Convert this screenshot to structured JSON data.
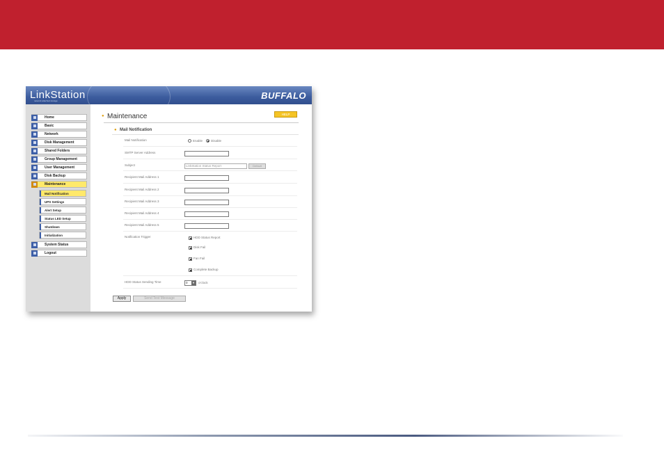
{
  "colors": {
    "banner": "#c0202e",
    "header": "#3c5c9e",
    "accent_yellow": "#ffe96a",
    "nav_icon": "#3d5fa7"
  },
  "header": {
    "logo_text": "LinkStation",
    "logo_tagline": "network attached storage",
    "brand": "BUFFALO"
  },
  "sidebar": {
    "items": [
      {
        "label": "Home",
        "icon": "home-icon"
      },
      {
        "label": "Basic",
        "icon": "basic-settings-icon"
      },
      {
        "label": "Network",
        "icon": "network-icon"
      },
      {
        "label": "Disk Management",
        "icon": "disk-icon"
      },
      {
        "label": "Shared Folders",
        "icon": "folder-icon"
      },
      {
        "label": "Group Management",
        "icon": "group-icon"
      },
      {
        "label": "User Management",
        "icon": "user-icon"
      },
      {
        "label": "Disk Backup",
        "icon": "backup-icon"
      },
      {
        "label": "Maintenance",
        "icon": "tools-icon",
        "active": true
      },
      {
        "label": "System Status",
        "icon": "status-icon"
      },
      {
        "label": "Logout",
        "icon": "logout-icon"
      }
    ],
    "subitems": [
      {
        "label": "Mail Notification",
        "active": true
      },
      {
        "label": "UPS Settings"
      },
      {
        "label": "Alert Setup"
      },
      {
        "label": "Status LED Setup"
      },
      {
        "label": "Shutdown"
      },
      {
        "label": "Initialization"
      }
    ]
  },
  "main": {
    "title": "Maintenance",
    "help_label": "HELP",
    "section_title": "Mail Notification",
    "fields": {
      "mail_notification_label": "Mail Notification",
      "enable_label": "Enable",
      "disable_label": "Disable",
      "selected": "Disable",
      "smtp_label": "SMTP Server Address",
      "subject_label": "Subject",
      "subject_value": "LinkStation Status Report",
      "default_label": "Default",
      "recipient_labels": [
        "Recipient Mail Address 1",
        "Recipient Mail Address 2",
        "Recipient Mail Address 3",
        "Recipient Mail Address 4",
        "Recipient Mail Address 5"
      ],
      "trigger_label": "Notification Trigger",
      "triggers": [
        {
          "label": "HDD Status Report",
          "checked": true
        },
        {
          "label": "Disk Fail",
          "checked": true
        },
        {
          "label": "Fan Fail",
          "checked": true
        },
        {
          "label": "Complete Backup",
          "checked": true
        }
      ],
      "sending_time_label": "HDD Status Sending Time",
      "sending_time_value": "0",
      "each_label": "o'clock"
    },
    "apply_label": "Apply",
    "send_test_label": "Send Test Message"
  }
}
